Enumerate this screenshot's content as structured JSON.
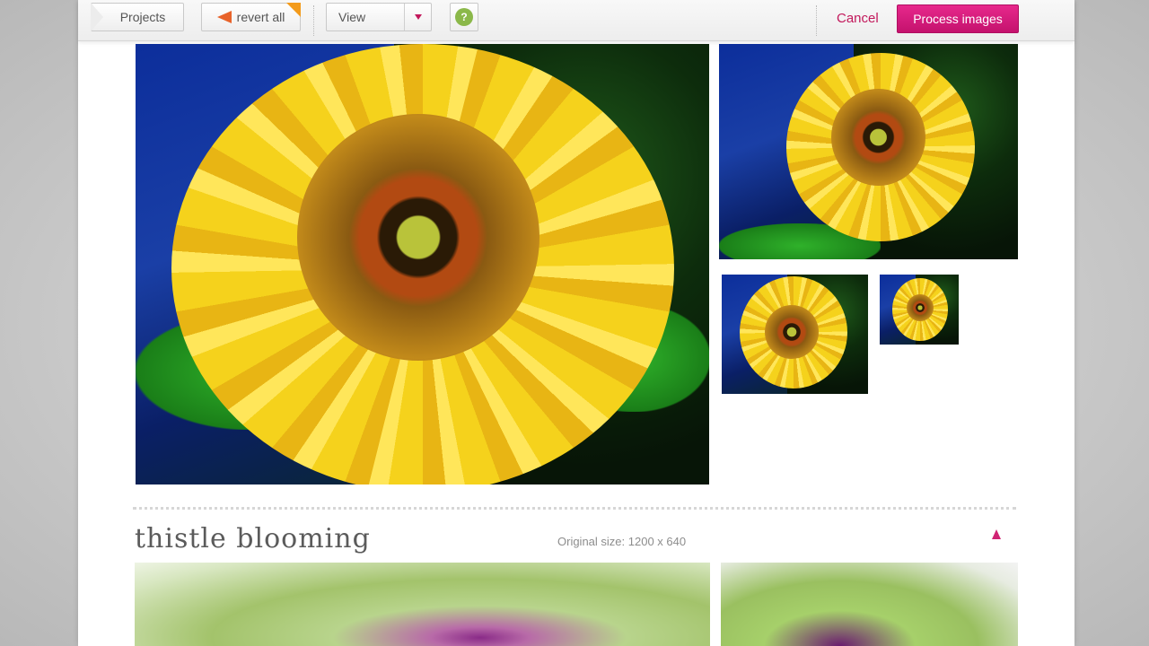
{
  "toolbar": {
    "projects_label": "Projects",
    "revert_label": "revert all",
    "view_label": "View",
    "help_label": "?",
    "cancel_label": "Cancel",
    "process_label": "Process images"
  },
  "icons": {
    "revert": "revert-arrow-icon",
    "view_caret": "chevron-down-icon",
    "help": "help-icon",
    "collapse": "triangle-up-icon"
  },
  "colors": {
    "accent": "#c2185b",
    "process_button": "#d81b7a",
    "help_green": "#8bb84a",
    "revert_orange": "#e8632a"
  },
  "section": {
    "title": "thistle blooming",
    "original_size": "Original size: 1200 x 640"
  }
}
